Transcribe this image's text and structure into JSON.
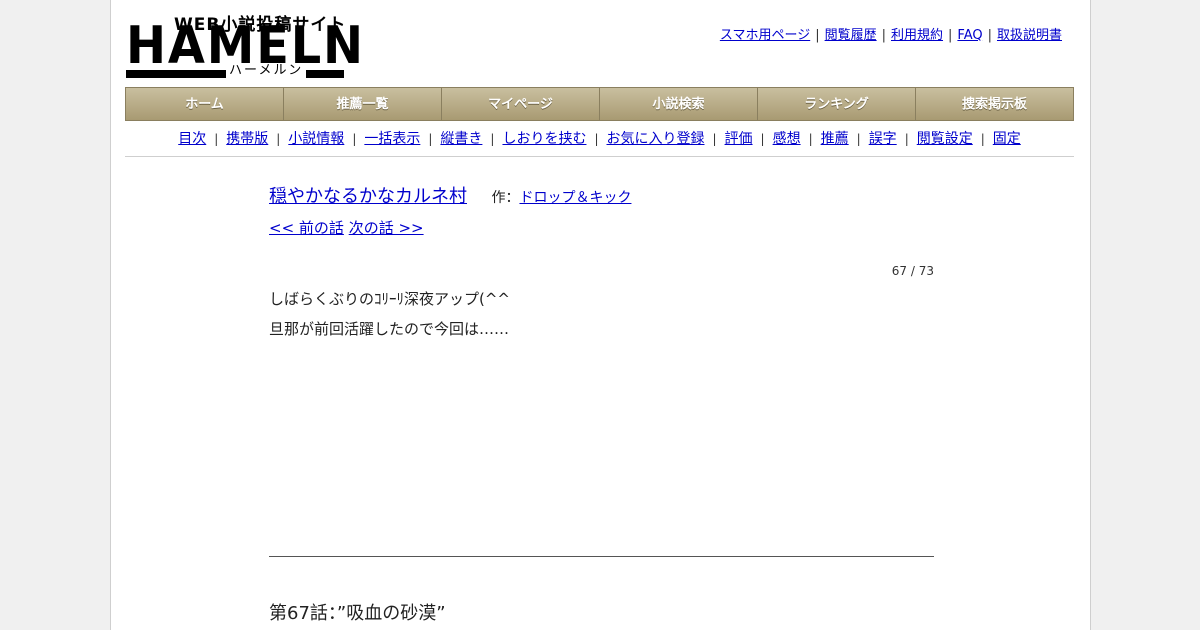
{
  "logo": {
    "subtitle": "WEB小説投稿サイト",
    "main": "HAMELN",
    "kana": "ハーメルン"
  },
  "top_links": [
    "スマホ用ページ",
    "閲覧履歴",
    "利用規約",
    "FAQ",
    "取扱説明書"
  ],
  "main_nav": [
    "ホーム",
    "推薦一覧",
    "マイページ",
    "小説検索",
    "ランキング",
    "捜索掲示板"
  ],
  "sub_nav": [
    "目次",
    "携帯版",
    "小説情報",
    "一括表示",
    "縦書き",
    "しおりを挟む",
    "お気に入り登録",
    "評価",
    "感想",
    "推薦",
    "誤字",
    "閲覧設定",
    "固定"
  ],
  "novel": {
    "title": "穏やかなるかなカルネ村",
    "author_prefix": "作：",
    "author": "ドロップ＆キック",
    "prev": "<< 前の話",
    "next": "次の話 >>",
    "page_count": "67 / 73",
    "foreword_line1": "しばらくぶりのｺﾘｰﾘ深夜アップ(^^",
    "foreword_line2": "旦那が前回活躍したので今回は……",
    "chapter_title": "第67話：”吸血の砂漠”"
  },
  "colors": {
    "nav_gradient_top": "#c9bf9f",
    "nav_gradient_bottom": "#a89a72",
    "link": "#0000cc"
  }
}
